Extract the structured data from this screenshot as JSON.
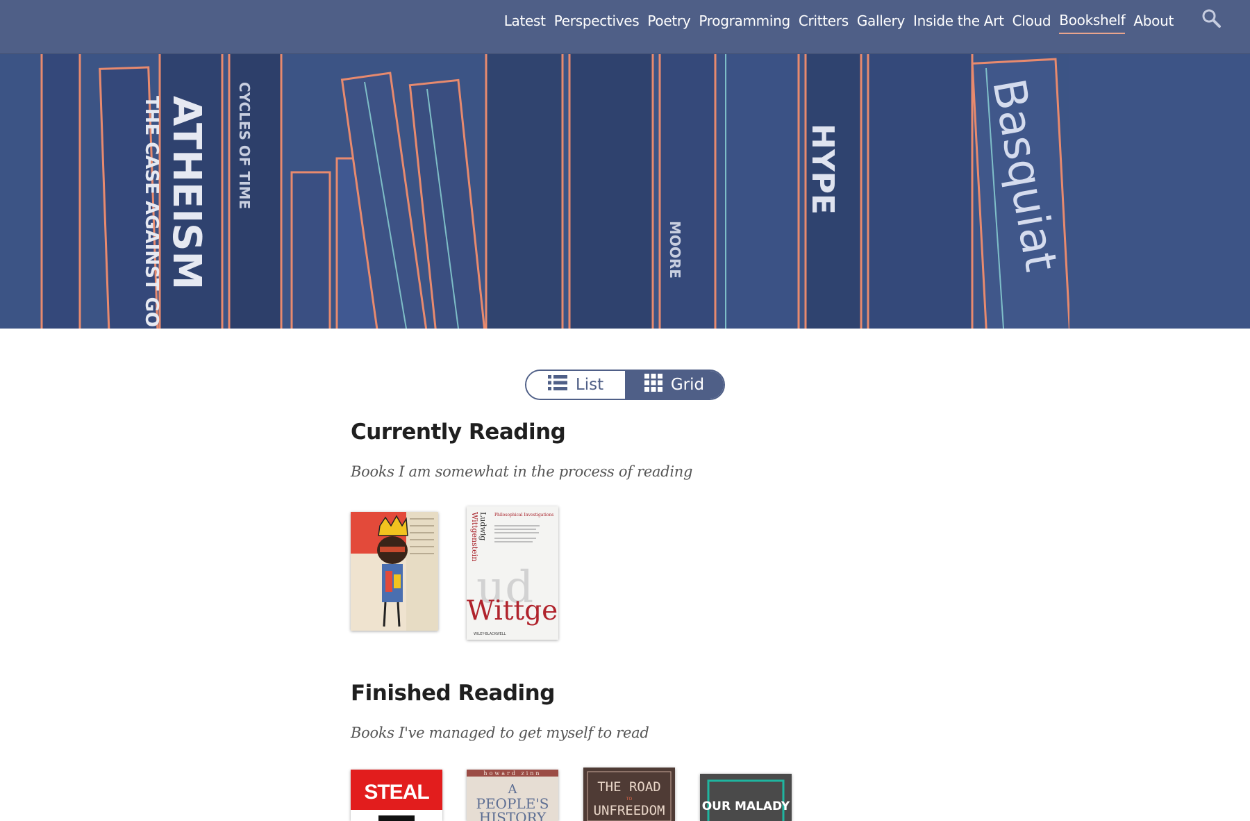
{
  "nav": {
    "items": [
      {
        "label": "Latest"
      },
      {
        "label": "Perspectives"
      },
      {
        "label": "Poetry"
      },
      {
        "label": "Programming"
      },
      {
        "label": "Critters"
      },
      {
        "label": "Gallery"
      },
      {
        "label": "Inside the Art"
      },
      {
        "label": "Cloud"
      },
      {
        "label": "Bookshelf",
        "active": true
      },
      {
        "label": "About"
      }
    ],
    "search_icon": "search-icon"
  },
  "hero": {
    "spine_texts": [
      "ATHEISM",
      "THE CASE AGAINST GOD",
      "CYCLES OF TIME",
      "HYPE",
      "Basquiat",
      "MOORE"
    ]
  },
  "view_toggle": {
    "list_label": "List",
    "grid_label": "Grid",
    "selected": "Grid"
  },
  "sections": {
    "current": {
      "title": "Currently Reading",
      "subtitle": "Books I am somewhat in the process of reading"
    },
    "finished": {
      "title": "Finished Reading",
      "subtitle": "Books I've managed to get myself to read"
    }
  },
  "books": {
    "basquiat": {
      "cover_text": ""
    },
    "wittgenstein": {
      "author_first": "Ludwig",
      "author_last": "Wittgenstein",
      "title": "Philosophical Investigations",
      "big": "Wittge",
      "publisher": "WILEY-BLACKWELL"
    },
    "steal": {
      "cover_text": "STEAL"
    },
    "peoples_history": {
      "author": "howard zinn",
      "line1": "A",
      "line2": "PEOPLE'S",
      "line3": "HISTORY"
    },
    "road_unfreedom": {
      "line1": "THE ROAD",
      "line2": "TO",
      "line3": "UNFREEDOM"
    },
    "our_malady": {
      "cover_text": "OUR MALADY"
    }
  },
  "colors": {
    "nav_bg": "#4f5f87",
    "accent_underline": "#e9a58d",
    "hero_bg": "#3c5485"
  }
}
